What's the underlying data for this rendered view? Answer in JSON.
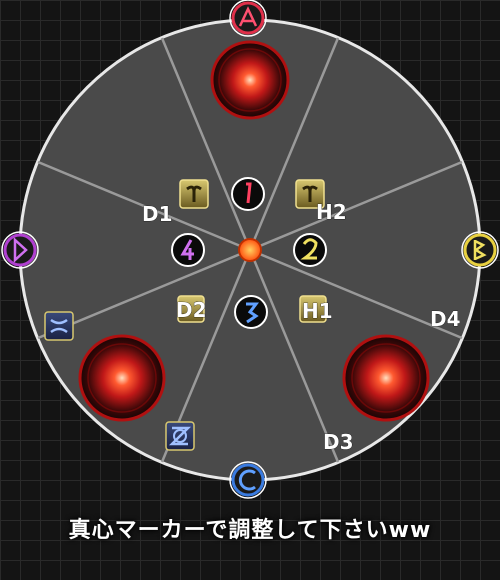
{
  "caption": "真心マーカーで調整して下さいww",
  "waymarks": [
    {
      "name": "waymark-a",
      "glyph": "A",
      "color": "#e0304a"
    },
    {
      "name": "waymark-b",
      "glyph": "B",
      "color": "#e8d040"
    },
    {
      "name": "waymark-c",
      "glyph": "C",
      "color": "#3a7be0"
    },
    {
      "name": "waymark-d",
      "glyph": "D",
      "color": "#b040d0"
    }
  ],
  "role_labels": [
    "D1",
    "H2",
    "D2",
    "H1",
    "D4",
    "D3"
  ],
  "numbered_markers": [
    {
      "name": "marker-1",
      "glyph": "1",
      "color": "#e0304a"
    },
    {
      "name": "marker-2",
      "glyph": "2",
      "color": "#e8d040"
    },
    {
      "name": "marker-3",
      "glyph": "3",
      "color": "#3a7be0"
    },
    {
      "name": "marker-4",
      "glyph": "4",
      "color": "#b040d0"
    }
  ],
  "colors": {
    "arena_fill": "#4a4a4a",
    "arena_border": "#e8e8e8",
    "spoke": "#9a9a9a",
    "aoe_ring": "#b01010",
    "center_dot": "#ff7a1a"
  }
}
